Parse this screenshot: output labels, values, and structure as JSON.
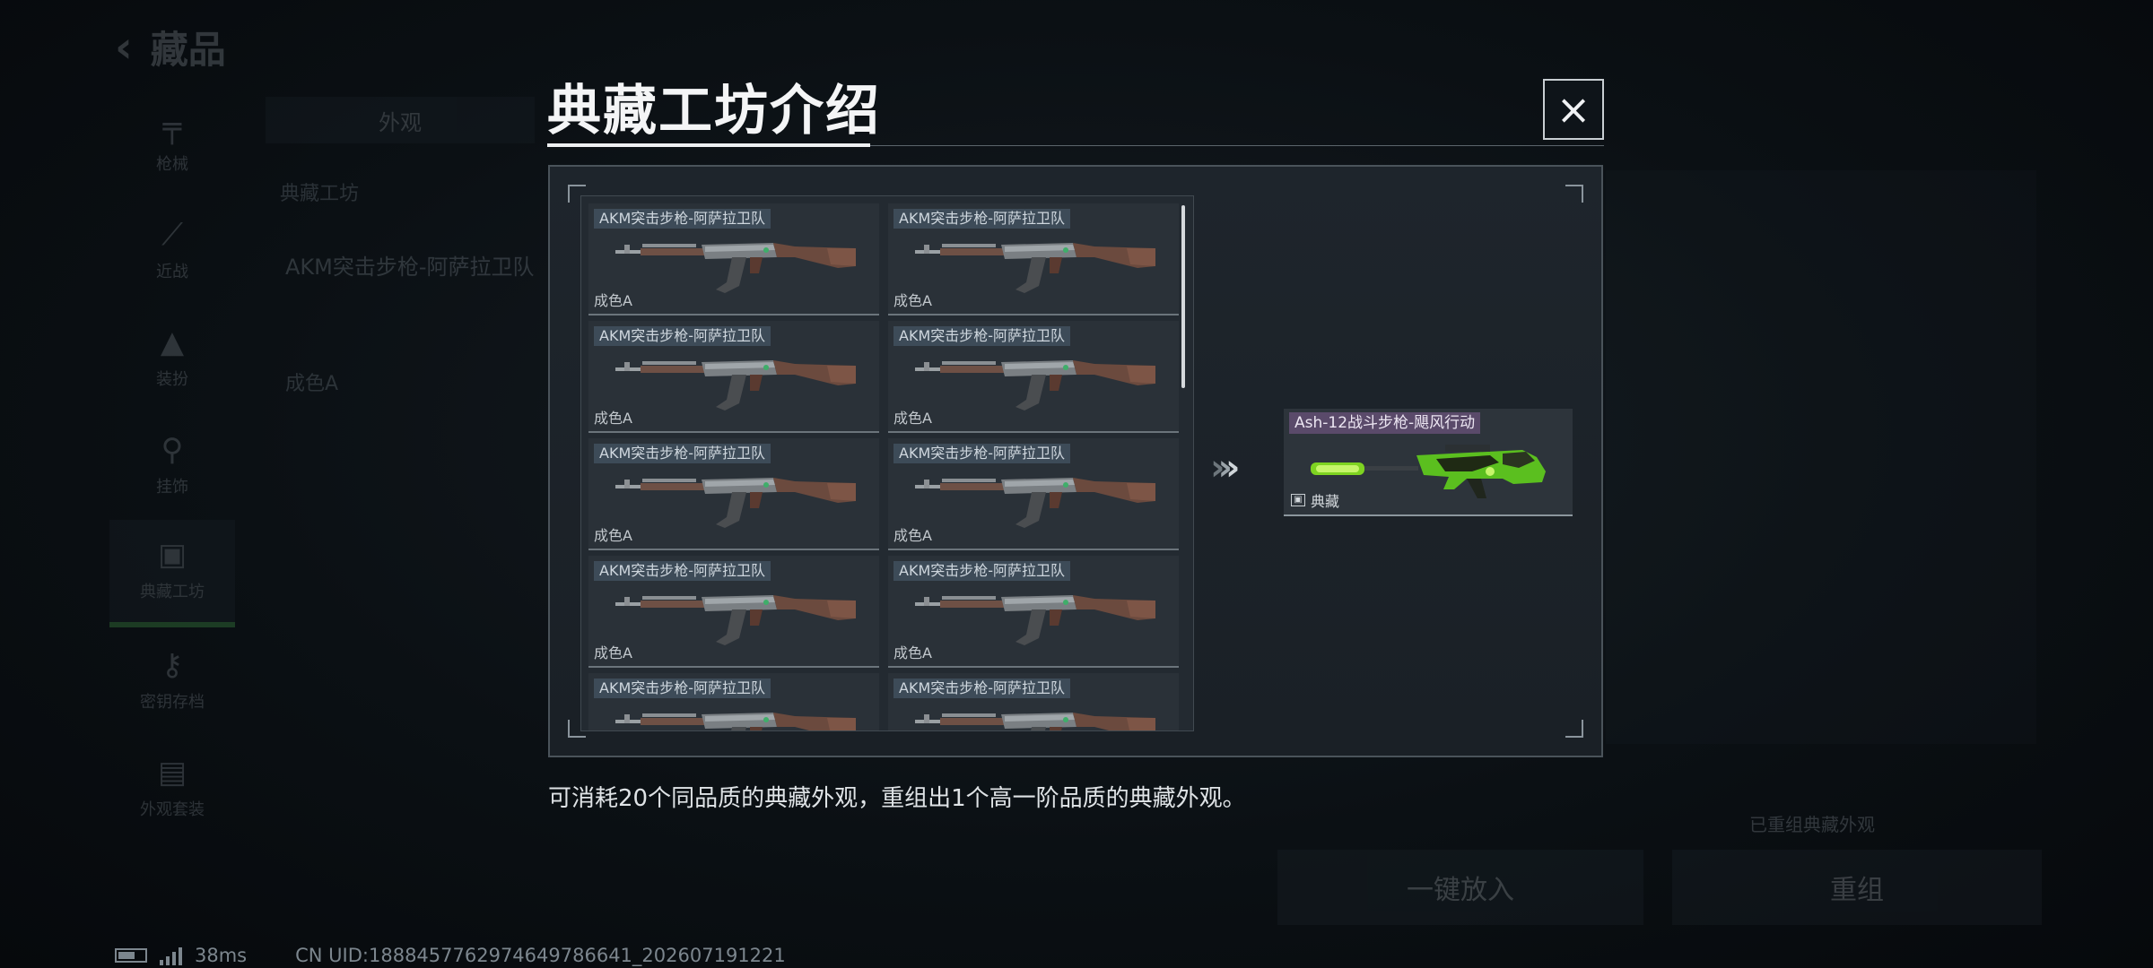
{
  "background": {
    "back_label": "藏品",
    "sidebar": [
      {
        "icon": "gun-icon",
        "label": "枪械"
      },
      {
        "icon": "knife-icon",
        "label": "近战"
      },
      {
        "icon": "hat-icon",
        "label": "装扮"
      },
      {
        "icon": "charm-icon",
        "label": "挂饰"
      },
      {
        "icon": "workshop-icon",
        "label": "典藏工坊"
      },
      {
        "icon": "key-icon",
        "label": "密钥存档"
      },
      {
        "icon": "bag-icon",
        "label": "外观套装"
      }
    ],
    "active_sidebar_index": 4,
    "tab_label": "外观",
    "line1": "典藏工坊",
    "line2": "AKM突击步枪-阿萨拉卫队",
    "line3": "成色A",
    "hint": "已重组典藏外观",
    "button_a": "一键放入",
    "button_b": "重组"
  },
  "modal": {
    "title": "典藏工坊介绍",
    "close_label": "×",
    "input_skins": [
      {
        "name": "AKM突击步枪-阿萨拉卫队",
        "grade": "成色A"
      },
      {
        "name": "AKM突击步枪-阿萨拉卫队",
        "grade": "成色A"
      },
      {
        "name": "AKM突击步枪-阿萨拉卫队",
        "grade": "成色A"
      },
      {
        "name": "AKM突击步枪-阿萨拉卫队",
        "grade": "成色A"
      },
      {
        "name": "AKM突击步枪-阿萨拉卫队",
        "grade": "成色A"
      },
      {
        "name": "AKM突击步枪-阿萨拉卫队",
        "grade": "成色A"
      },
      {
        "name": "AKM突击步枪-阿萨拉卫队",
        "grade": "成色A"
      },
      {
        "name": "AKM突击步枪-阿萨拉卫队",
        "grade": "成色A"
      },
      {
        "name": "AKM突击步枪-阿萨拉卫队",
        "grade": ""
      },
      {
        "name": "AKM突击步枪-阿萨拉卫队",
        "grade": ""
      }
    ],
    "arrow_glyph": "›",
    "result": {
      "name": "Ash-12战斗步枪-飓风行动",
      "grade": "典藏",
      "grade_icon": "image-icon"
    },
    "description": "可消耗20个同品质的典藏外观，重组出1个高一阶品质的典藏外观。"
  },
  "status": {
    "ping": "38ms",
    "uid": "CN UID:1888457762974649786641_202607191221"
  },
  "colors": {
    "input_label_bg": "#3d4b58",
    "result_label_bg": "#5a4a6a",
    "result_accent": "#7ed321",
    "arrow": "#cfd5d9"
  }
}
